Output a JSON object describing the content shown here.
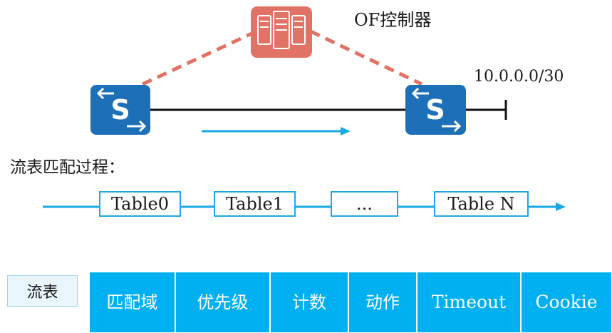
{
  "controller": {
    "label": "OF控制器",
    "color": "#e07366"
  },
  "link": {
    "prefix": "10.0.0.0/30"
  },
  "process": {
    "title": "流表匹配过程：",
    "tables": [
      "Table0",
      "Table1",
      "...",
      "Table N"
    ]
  },
  "flow_table": {
    "label": "流表",
    "fields": [
      "匹配域",
      "优先级",
      "计数",
      "动作",
      "Timeout",
      "Cookie"
    ]
  },
  "colors": {
    "switch": "#1d6fb8",
    "arrow": "#19a8e4",
    "field_bg": "#00b0f0"
  },
  "icons": [
    "server-icon",
    "switch-icon"
  ]
}
